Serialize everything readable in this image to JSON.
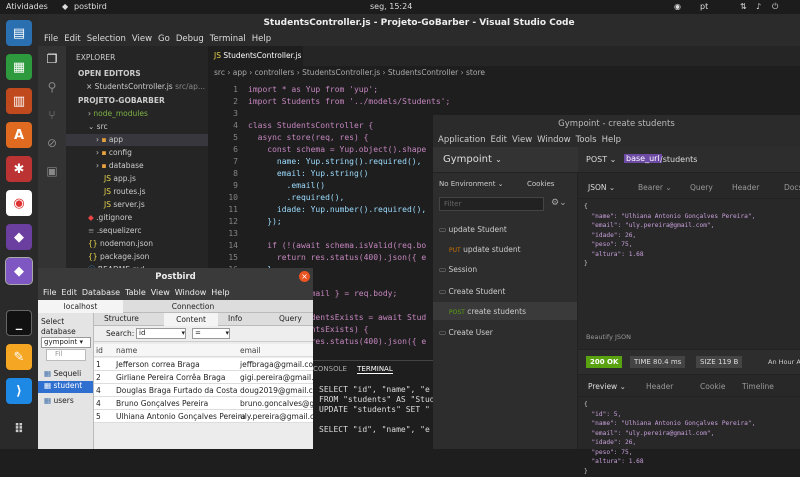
{
  "topbar": {
    "activities": "Atividades",
    "app": "postbird",
    "clock": "seg, 15:24",
    "lang": "pt"
  },
  "vscode": {
    "title": "StudentsController.js - Projeto-GoBarber - Visual Studio Code",
    "menu": [
      "File",
      "Edit",
      "Selection",
      "View",
      "Go",
      "Debug",
      "Terminal",
      "Help"
    ],
    "explorer_header": "EXPLORER",
    "open_editors": "OPEN EDITORS",
    "open_file": "StudentsController.js",
    "open_path": "src/ap...",
    "project": "PROJETO-GOBARBER",
    "tree": [
      "node_modules",
      "src",
      "app",
      "config",
      "database",
      "app.js",
      "routes.js",
      "server.js",
      ".gitignore",
      ".sequelizerc",
      "nodemon.json",
      "package.json",
      "README.md"
    ],
    "tab": "StudentsController.js",
    "breadcrumb": [
      "src",
      "app",
      "controllers",
      "StudentsController.js",
      "StudentsController",
      "store"
    ],
    "code": [
      {
        "n": "1",
        "t": "import * as Yup from 'yup';"
      },
      {
        "n": "2",
        "t": "import Students from '../models/Students';"
      },
      {
        "n": "3",
        "t": ""
      },
      {
        "n": "4",
        "t": "class StudentsController {"
      },
      {
        "n": "5",
        "t": "  async store(req, res) {"
      },
      {
        "n": "6",
        "t": "    const schema = Yup.object().shape"
      },
      {
        "n": "7",
        "t": "      name: Yup.string().required(),"
      },
      {
        "n": "8",
        "t": "      email: Yup.string()"
      },
      {
        "n": "9",
        "t": "        .email()"
      },
      {
        "n": "10",
        "t": "        .required(),"
      },
      {
        "n": "11",
        "t": "      idade: Yup.number().required(),"
      },
      {
        "n": "12",
        "t": "    });"
      },
      {
        "n": "13",
        "t": ""
      },
      {
        "n": "14",
        "t": "    if (!(await schema.isValid(req.bo"
      },
      {
        "n": "15",
        "t": "      return res.status(400).json({ e"
      },
      {
        "n": "16",
        "t": "    }"
      },
      {
        "n": "17",
        "t": ""
      },
      {
        "n": "18",
        "t": "    const { email } = req.body;"
      },
      {
        "n": "19",
        "t": ""
      },
      {
        "n": "20",
        "t": "    const studentsExists = await Stud"
      },
      {
        "n": "21",
        "t": "    if (studentsExists) {"
      },
      {
        "n": "22",
        "t": "      return res.status(400).json({ e"
      }
    ],
    "term_tabs": [
      "CONSOLE",
      "TERMINAL"
    ],
    "term_lines": [
      "SELECT \"id\", \"name\", \"e",
      "FROM \"students\" AS \"Stud",
      "UPDATE \"students\" SET \"",
      "",
      "SELECT \"id\", \"name\", \"e"
    ]
  },
  "insomnia": {
    "title": "Gympoint - create students",
    "menu": [
      "Application",
      "Edit",
      "View",
      "Window",
      "Tools",
      "Help"
    ],
    "workspace": "Gympoint",
    "env": "No Environment",
    "cookies": "Cookies",
    "filter_placeholder": "Filter",
    "items": [
      {
        "label": "update Student",
        "type": "folder"
      },
      {
        "label": "update student",
        "method": "PUT"
      },
      {
        "label": "Session",
        "type": "folder"
      },
      {
        "label": "Create Student",
        "type": "folder"
      },
      {
        "label": "create students",
        "method": "POST"
      },
      {
        "label": "Create User",
        "type": "folder"
      }
    ],
    "method": "POST",
    "base_url": "base_url",
    "path": "/students",
    "req_tabs": [
      "JSON",
      "Bearer",
      "Query",
      "Header",
      "Docs"
    ],
    "body_lines": [
      "{",
      "  \"name\": \"Ulhiana Antonio Gonçalves Pereira\",",
      "  \"email\": \"uly.pereira@gmail.com\",",
      "  \"idade\": 26,",
      "  \"peso\": 75,",
      "  \"altura\": 1.68",
      "}"
    ],
    "beautify": "Beautify JSON",
    "status": "200 OK",
    "time": "TIME 80.4 ms",
    "size": "SIZE 119 B",
    "ago": "An Hour A",
    "res_tabs": [
      "Preview",
      "Header",
      "Cookie",
      "Timeline"
    ],
    "res_lines": [
      "{",
      "  \"id\": 5,",
      "  \"name\": \"Ulhiana Antonio Gonçalves Pereira\",",
      "  \"email\": \"uly.pereira@gmail.com\",",
      "  \"idade\": 26,",
      "  \"peso\": 75,",
      "  \"altura\": 1.68",
      "}"
    ]
  },
  "postbird": {
    "title": "Postbird",
    "menu": [
      "File",
      "Edit",
      "Database",
      "Table",
      "View",
      "Window",
      "Help"
    ],
    "conn_tabs": [
      "localhost",
      "Connection"
    ],
    "select_db": "Select database",
    "db": "gympoint",
    "filter_placeholder": "Fil",
    "tables": [
      "Sequeli",
      "student",
      "users"
    ],
    "tabs": [
      "Structure",
      "Content",
      "Info",
      "Query"
    ],
    "search_label": "Search:",
    "search_field": "id",
    "search_op": "=",
    "headers": [
      "id",
      "name",
      "email"
    ],
    "rows": [
      [
        "1",
        "Jefferson correa Braga",
        "jeffbraga@gmail.com"
      ],
      [
        "2",
        "Girliane Pereira Corrêa Braga",
        "gigi.pereira@gmail.co"
      ],
      [
        "4",
        "Douglas Braga Furtado da Costa",
        "doug2019@gmail.com"
      ],
      [
        "4",
        "Bruno Gonçalves Pereira",
        "bruno.goncalves@gm"
      ],
      [
        "5",
        "Ulhiana Antonio Gonçalves Pereira",
        "uly.pereira@gmail.co"
      ]
    ]
  }
}
